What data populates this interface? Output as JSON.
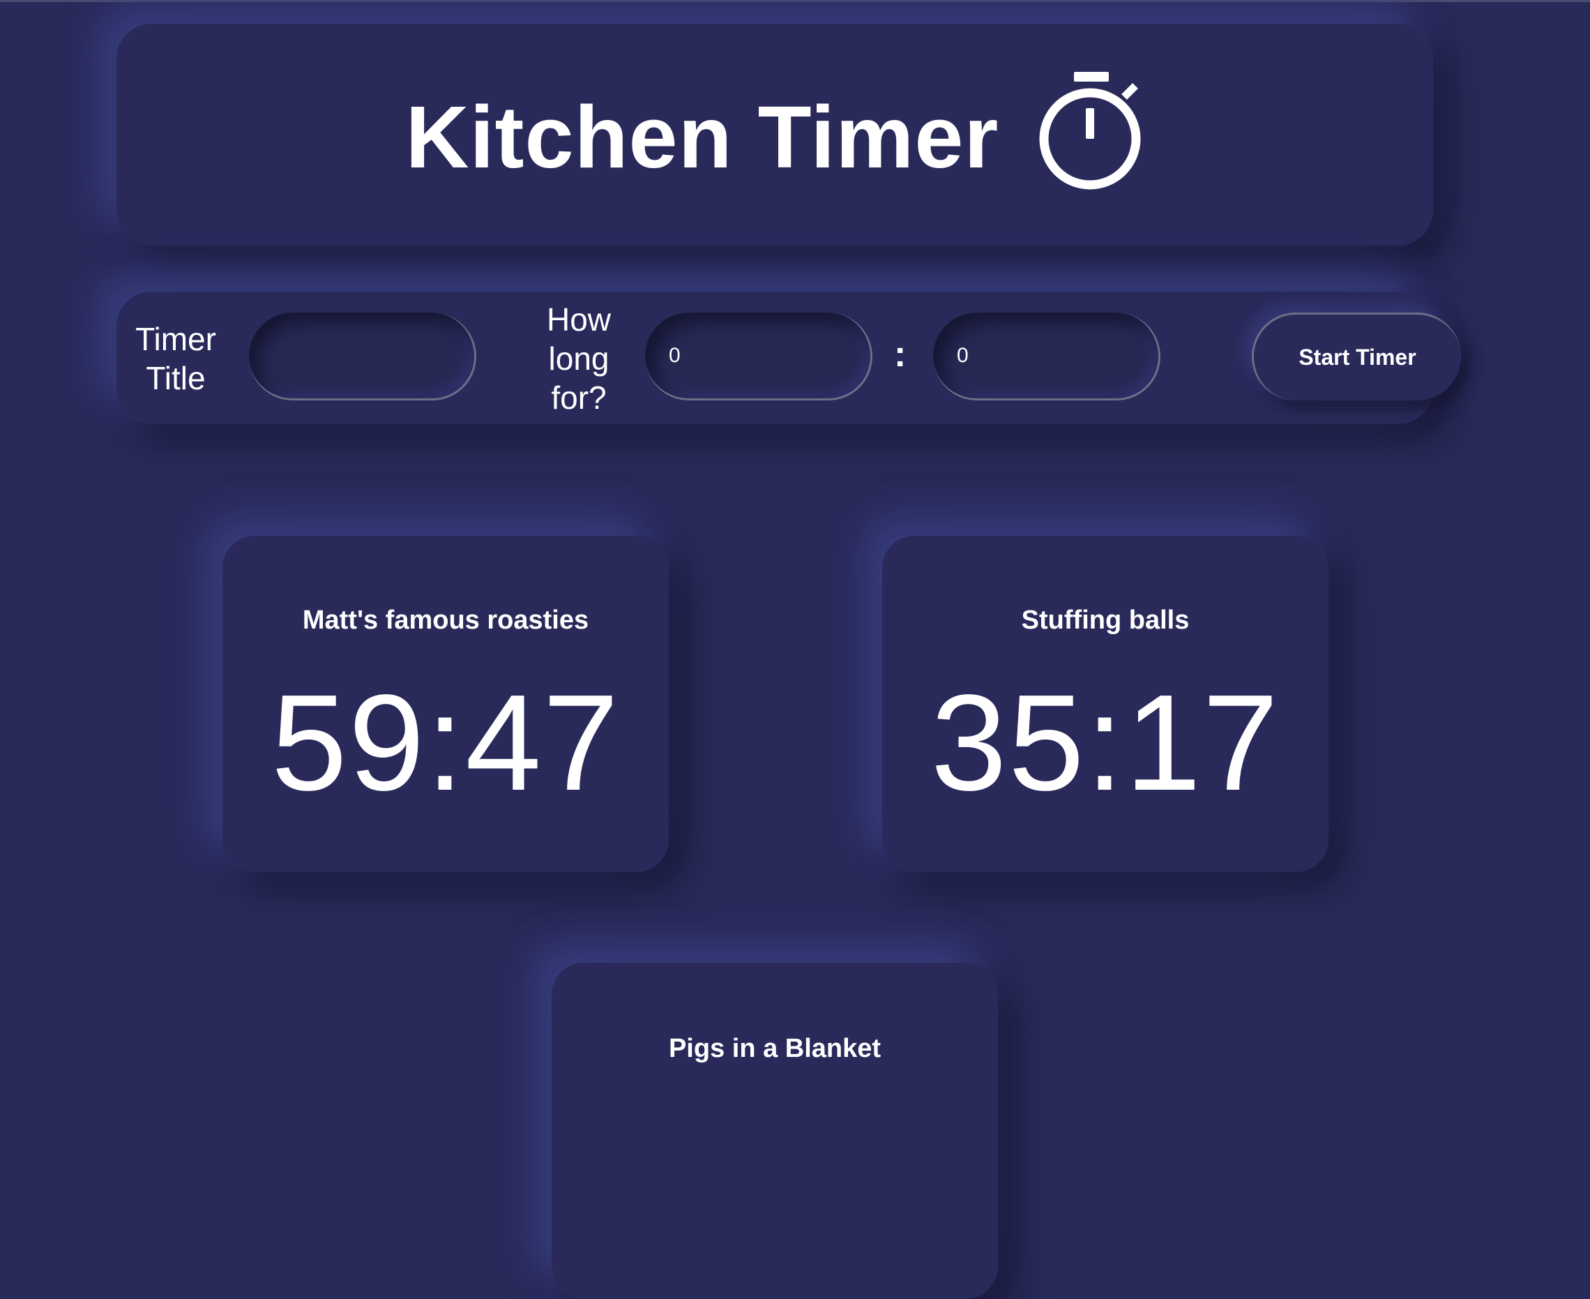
{
  "header": {
    "title": "Kitchen Timer",
    "icon": "stopwatch-icon"
  },
  "form": {
    "title_label": "Timer Title",
    "title_value": "",
    "duration_label": "How long for?",
    "minutes_value": "0",
    "separator": ":",
    "seconds_value": "0",
    "start_button_label": "Start Timer"
  },
  "timers": [
    {
      "name": "Matt's famous roasties",
      "time": "59:47"
    },
    {
      "name": "Stuffing balls",
      "time": "35:17"
    },
    {
      "name": "Pigs in a Blanket",
      "time": ""
    }
  ],
  "colors": {
    "background": "#292a5a",
    "text": "#ffffff",
    "input_border": "#6e6f86"
  }
}
